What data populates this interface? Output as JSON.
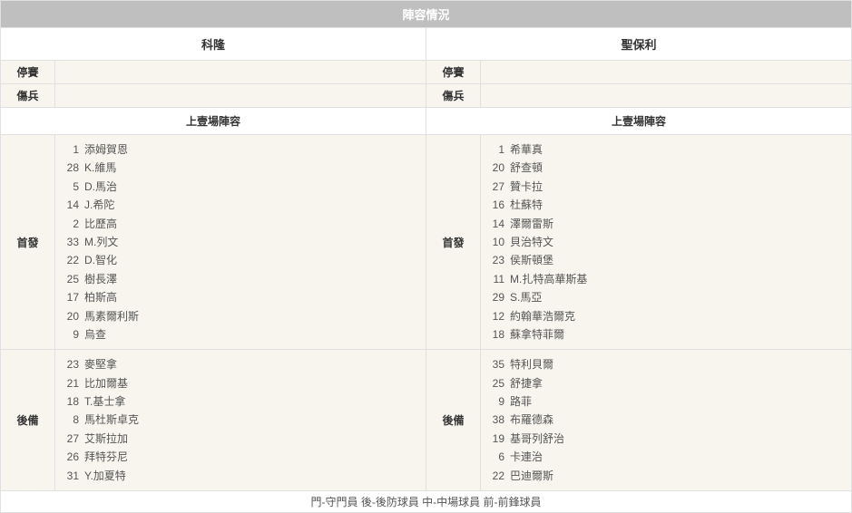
{
  "title": "陣容情況",
  "teams": {
    "left": {
      "name": "科隆"
    },
    "right": {
      "name": "聖保利"
    }
  },
  "labels": {
    "suspended": "停賽",
    "injured": "傷兵",
    "last_lineup": "上壹場陣容",
    "starters": "首發",
    "subs": "後備"
  },
  "left": {
    "suspended": "",
    "injured": "",
    "starters": [
      {
        "num": "1",
        "name": "添姆賀恩"
      },
      {
        "num": "28",
        "name": "K.維馬"
      },
      {
        "num": "5",
        "name": "D.馬治"
      },
      {
        "num": "14",
        "name": "J.希陀"
      },
      {
        "num": "2",
        "name": "比歷高"
      },
      {
        "num": "33",
        "name": "M.列文"
      },
      {
        "num": "22",
        "name": "D.智化"
      },
      {
        "num": "25",
        "name": "樹長澤"
      },
      {
        "num": "17",
        "name": "柏斯高"
      },
      {
        "num": "20",
        "name": "馬素爾利斯"
      },
      {
        "num": "9",
        "name": "烏查"
      }
    ],
    "subs": [
      {
        "num": "23",
        "name": "麥堅拿"
      },
      {
        "num": "21",
        "name": "比加爾基"
      },
      {
        "num": "18",
        "name": "T.基士拿"
      },
      {
        "num": "8",
        "name": "馬杜斯卓克"
      },
      {
        "num": "27",
        "name": "艾斯拉加"
      },
      {
        "num": "26",
        "name": "拜特芬尼"
      },
      {
        "num": "31",
        "name": "Y.加夏特"
      }
    ]
  },
  "right": {
    "suspended": "",
    "injured": "",
    "starters": [
      {
        "num": "1",
        "name": "希華真"
      },
      {
        "num": "20",
        "name": "舒查頓"
      },
      {
        "num": "27",
        "name": "贊卡拉"
      },
      {
        "num": "16",
        "name": "杜蘇特"
      },
      {
        "num": "14",
        "name": "澤爾雷斯"
      },
      {
        "num": "10",
        "name": "貝治特文"
      },
      {
        "num": "23",
        "name": "侯斯頓堡"
      },
      {
        "num": "11",
        "name": "M.扎特高華斯基"
      },
      {
        "num": "29",
        "name": "S.馬亞"
      },
      {
        "num": "12",
        "name": "約翰華浩爾克"
      },
      {
        "num": "18",
        "name": "蘇拿特菲爾"
      }
    ],
    "subs": [
      {
        "num": "35",
        "name": "特利貝爾"
      },
      {
        "num": "25",
        "name": "舒捷拿"
      },
      {
        "num": "9",
        "name": "路菲"
      },
      {
        "num": "38",
        "name": "布羅德森"
      },
      {
        "num": "19",
        "name": "基哥列舒治"
      },
      {
        "num": "6",
        "name": "卡連治"
      },
      {
        "num": "22",
        "name": "巴迪爾斯"
      }
    ]
  },
  "footer": "門-守門員 後-後防球員 中-中場球員 前-前鋒球員"
}
